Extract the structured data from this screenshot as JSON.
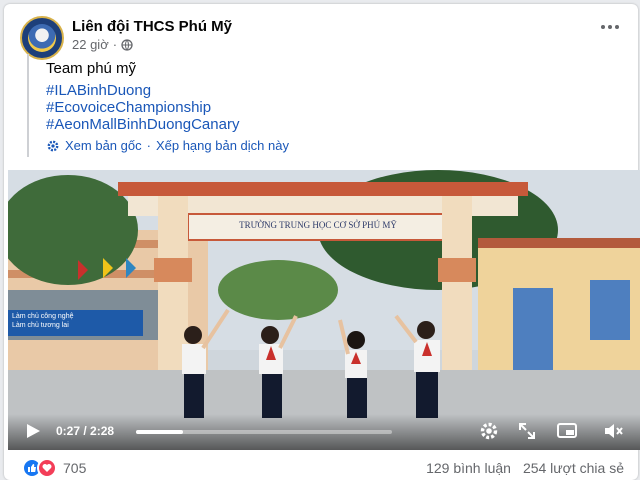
{
  "post": {
    "page_name": "Liên đội THCS Phú Mỹ",
    "timestamp": "22 giờ",
    "separator": "·",
    "text": "Team phú mỹ",
    "hashtags": [
      "#ILABinhDuong",
      "#EcovoiceChampionship",
      "#AeonMallBinhDuongCanary"
    ],
    "see_original": "Xem bản gốc",
    "rate_translation": "Xếp hạng bản dịch này",
    "dot": "·"
  },
  "video": {
    "current_time": "0:27",
    "time_sep": " / ",
    "duration": "2:28",
    "progress_fraction": 0.182,
    "gate_sign": "TRƯỜNG TRUNG HỌC CƠ SỞ PHÚ MỸ",
    "banner_line1": "Làm chủ công nghệ",
    "banner_line2": "Làm chủ tương lai"
  },
  "footer": {
    "reaction_count": "705",
    "comments": "129 bình luận",
    "shares": "254 lượt chia sẻ"
  },
  "colors": {
    "link": "#1a57b8",
    "like": "#1877f2",
    "love": "#f33e58",
    "muted": "#65676b"
  },
  "icons": [
    "globe-icon",
    "more-icon",
    "gear-icon",
    "play-icon",
    "settings-icon",
    "fullscreen-icon",
    "pip-icon",
    "mute-icon",
    "like-icon",
    "love-icon"
  ]
}
